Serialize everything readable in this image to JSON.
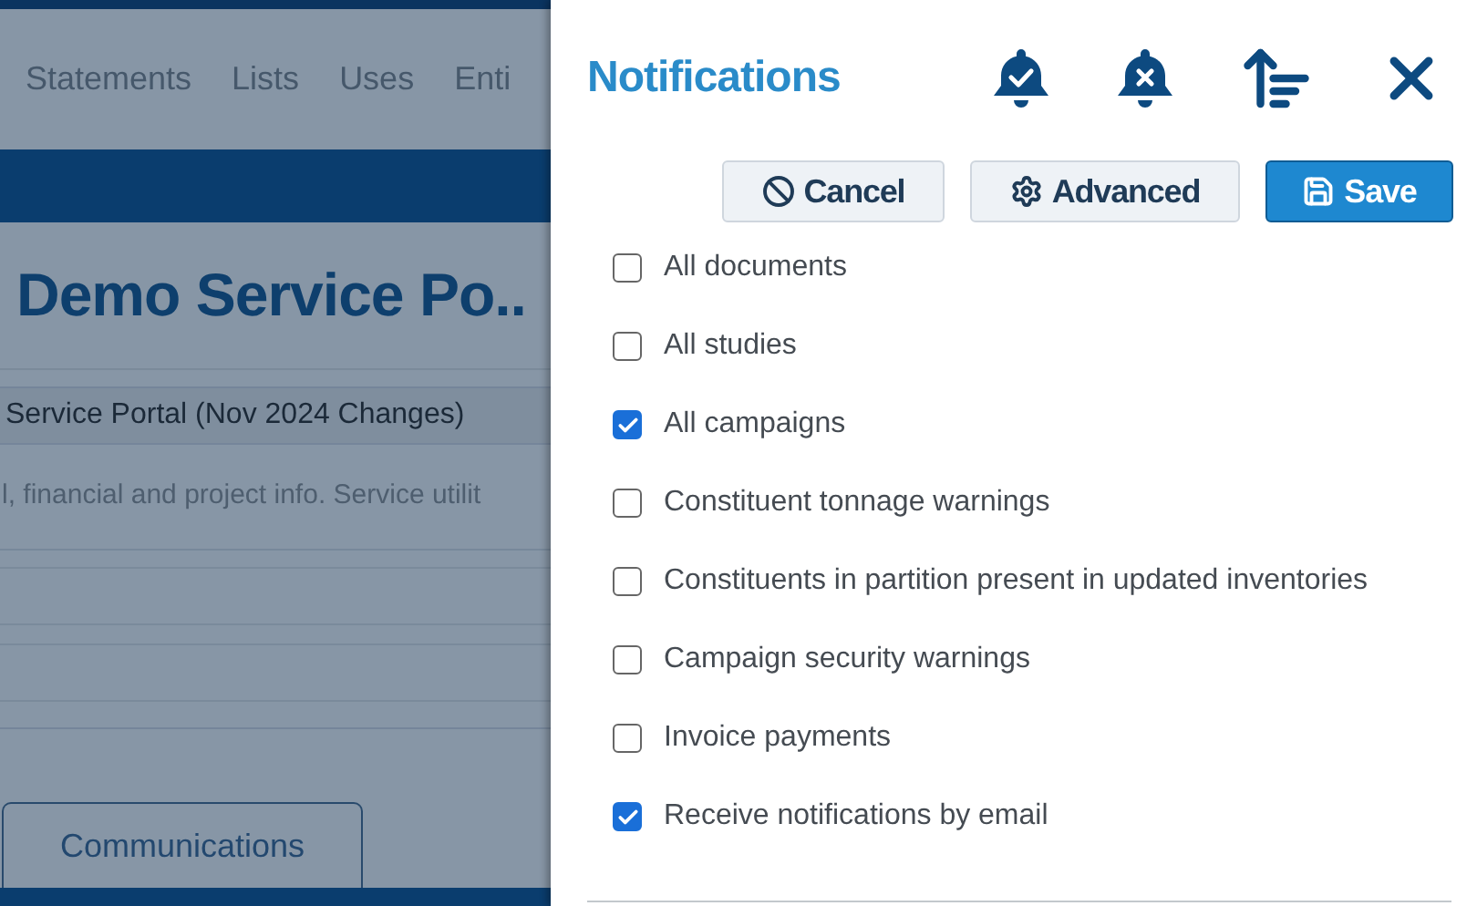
{
  "background": {
    "nav_tabs": [
      "Statements",
      "Lists",
      "Uses",
      "Enti"
    ],
    "page_title": "Demo Service Po..",
    "subtitle": "Service Portal (Nov 2024 Changes)",
    "description": "l, financial and project info. Service utilit",
    "tab_button": "Communications"
  },
  "panel": {
    "title": "Notifications",
    "buttons": [
      {
        "label": "Cancel",
        "kind": "cancel"
      },
      {
        "label": "Advanced",
        "kind": "advanced"
      },
      {
        "label": "Save",
        "kind": "save"
      }
    ],
    "options": [
      {
        "label": "All documents",
        "checked": false
      },
      {
        "label": "All studies",
        "checked": false
      },
      {
        "label": "All campaigns",
        "checked": true
      },
      {
        "label": "Constituent tonnage warnings",
        "checked": false
      },
      {
        "label": "Constituents in partition present in updated inventories",
        "checked": false
      },
      {
        "label": "Campaign security warnings",
        "checked": false
      },
      {
        "label": "Invoice payments",
        "checked": false
      },
      {
        "label": "Receive notifications by email",
        "checked": true
      }
    ]
  }
}
